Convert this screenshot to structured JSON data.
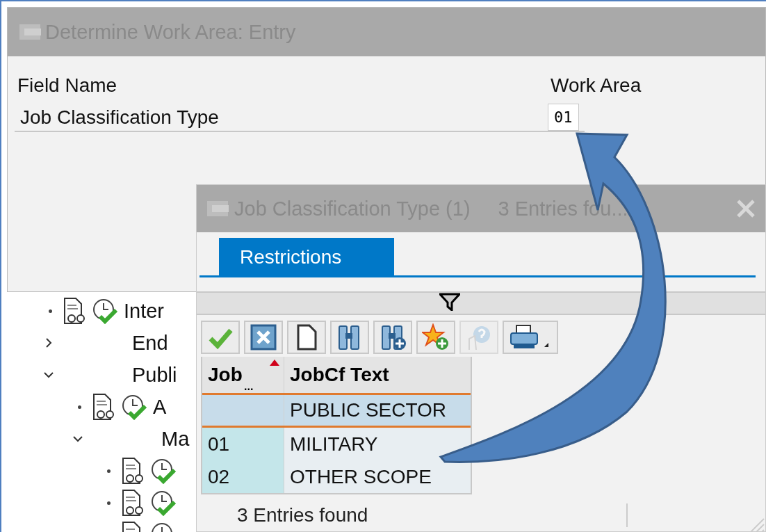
{
  "dialog": {
    "title": "Determine Work Area: Entry",
    "columns": [
      "Field Name",
      "Work Area"
    ],
    "field": {
      "label": "Job Classification Type",
      "value": "01"
    }
  },
  "tree": [
    {
      "kind": "leaf",
      "label": "Inter"
    },
    {
      "kind": "folder",
      "label": "End",
      "expanded": false
    },
    {
      "kind": "folder",
      "label": "Publi",
      "expanded": true,
      "children": [
        {
          "kind": "leaf",
          "label": "A"
        },
        {
          "kind": "folder",
          "label": "Ma",
          "expanded": true,
          "children": [
            {
              "kind": "leaf"
            },
            {
              "kind": "leaf"
            },
            {
              "kind": "leaf"
            }
          ]
        }
      ]
    }
  ],
  "popup": {
    "title": "Job Classification Type (1)",
    "subtitle": "3 Entries fou...",
    "tabs": [
      {
        "label": "Restrictions",
        "selected": true
      }
    ],
    "toolbar": [
      {
        "kind": "check",
        "disabled": false
      },
      {
        "kind": "cancel",
        "disabled": false
      },
      {
        "kind": "page",
        "disabled": false
      },
      {
        "kind": "find",
        "disabled": false
      },
      {
        "kind": "find-more",
        "disabled": false
      },
      {
        "kind": "favorite",
        "disabled": false
      },
      {
        "kind": "help",
        "disabled": true
      },
      {
        "kind": "print",
        "disabled": false
      }
    ],
    "table": {
      "columns": [
        {
          "label": "Job",
          "more": "...",
          "sorted": true
        },
        {
          "label": "JobCf Text",
          "sorted": false
        }
      ],
      "rows": [
        {
          "cells": [
            "",
            "PUBLIC SECTOR"
          ],
          "selected": true
        },
        {
          "cells": [
            "01",
            "MILITARY"
          ],
          "selected": false
        },
        {
          "cells": [
            "02",
            "OTHER SCOPE"
          ],
          "selected": false
        }
      ]
    },
    "status": "3 Entries found"
  }
}
